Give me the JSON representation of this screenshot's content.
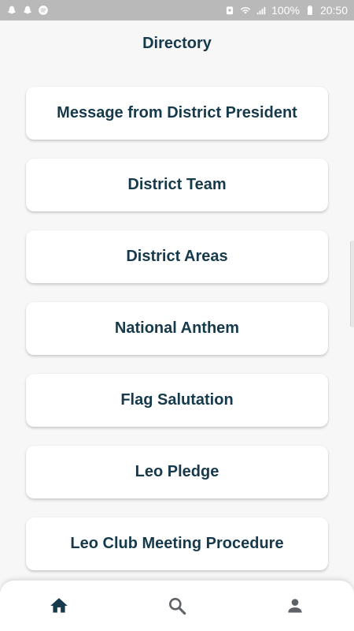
{
  "status_bar": {
    "battery": "100%",
    "time": "20:50",
    "left_icons": [
      "snapchat-icon",
      "snapchat-icon",
      "spotify-icon"
    ],
    "right_icons": [
      "alarm-icon",
      "wifi-icon",
      "signal-icon",
      "battery-icon"
    ]
  },
  "header": {
    "title": "Directory"
  },
  "directory": {
    "items": [
      {
        "label": "Message from District President"
      },
      {
        "label": "District Team"
      },
      {
        "label": "District Areas"
      },
      {
        "label": "National Anthem"
      },
      {
        "label": "Flag Salutation"
      },
      {
        "label": "Leo Pledge"
      },
      {
        "label": "Leo Club Meeting Procedure"
      }
    ]
  },
  "bottom_nav": {
    "items": [
      {
        "icon": "home-icon",
        "active": true
      },
      {
        "icon": "search-icon",
        "active": false
      },
      {
        "icon": "person-icon",
        "active": false
      }
    ],
    "active_color": "#163a4c",
    "inactive_color": "#5f6368"
  },
  "colors": {
    "accent": "#163a4c",
    "background": "#f7f7f7",
    "status_bar": "#b9b9b9"
  }
}
